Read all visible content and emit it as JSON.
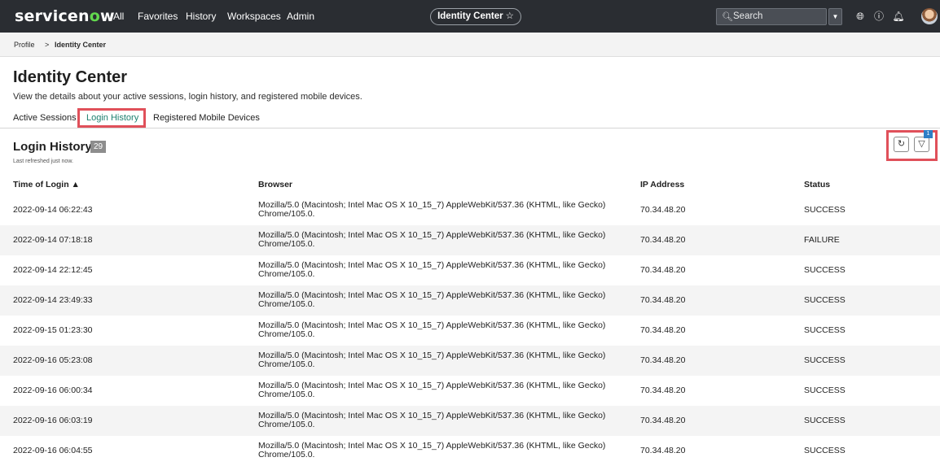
{
  "nav": {
    "logo_prefix": "servicen",
    "logo_o": "o",
    "logo_suffix": "w",
    "links": [
      "All",
      "Favorites",
      "History",
      "Workspaces",
      "Admin"
    ],
    "center_title": "Identity Center",
    "center_star": "☆",
    "search_placeholder": "Search"
  },
  "breadcrumb": {
    "items": [
      "Profile",
      "Identity Center"
    ],
    "separator": ">"
  },
  "page": {
    "title": "Identity Center",
    "description": "View the details about your active sessions, login history, and registered mobile devices."
  },
  "tabs": [
    {
      "label": "Active Sessions",
      "active": false
    },
    {
      "label": "Login History",
      "active": true
    },
    {
      "label": "Registered Mobile Devices",
      "active": false
    }
  ],
  "section": {
    "title": "Login History",
    "count": "29",
    "refreshed": "Last refreshed just now.",
    "filter_badge": "1"
  },
  "table": {
    "headers": [
      "Time of Login ▲",
      "Browser",
      "IP Address",
      "Status"
    ],
    "rows": [
      {
        "time": "2022-09-14 06:22:43",
        "browser_l1": "Mozilla/5.0 (Macintosh; Intel Mac OS X 10_15_7) AppleWebKit/537.36 (KHTML, like Gecko)",
        "browser_l2": "Chrome/105.0.",
        "ip": "70.34.48.20",
        "status": "SUCCESS"
      },
      {
        "time": "2022-09-14 07:18:18",
        "browser_l1": "Mozilla/5.0 (Macintosh; Intel Mac OS X 10_15_7) AppleWebKit/537.36 (KHTML, like Gecko)",
        "browser_l2": "Chrome/105.0.",
        "ip": "70.34.48.20",
        "status": "FAILURE"
      },
      {
        "time": "2022-09-14 22:12:45",
        "browser_l1": "Mozilla/5.0 (Macintosh; Intel Mac OS X 10_15_7) AppleWebKit/537.36 (KHTML, like Gecko)",
        "browser_l2": "Chrome/105.0.",
        "ip": "70.34.48.20",
        "status": "SUCCESS"
      },
      {
        "time": "2022-09-14 23:49:33",
        "browser_l1": "Mozilla/5.0 (Macintosh; Intel Mac OS X 10_15_7) AppleWebKit/537.36 (KHTML, like Gecko)",
        "browser_l2": "Chrome/105.0.",
        "ip": "70.34.48.20",
        "status": "SUCCESS"
      },
      {
        "time": "2022-09-15 01:23:30",
        "browser_l1": "Mozilla/5.0 (Macintosh; Intel Mac OS X 10_15_7) AppleWebKit/537.36 (KHTML, like Gecko)",
        "browser_l2": "Chrome/105.0.",
        "ip": "70.34.48.20",
        "status": "SUCCESS"
      },
      {
        "time": "2022-09-16 05:23:08",
        "browser_l1": "Mozilla/5.0 (Macintosh; Intel Mac OS X 10_15_7) AppleWebKit/537.36 (KHTML, like Gecko)",
        "browser_l2": "Chrome/105.0.",
        "ip": "70.34.48.20",
        "status": "SUCCESS"
      },
      {
        "time": "2022-09-16 06:00:34",
        "browser_l1": "Mozilla/5.0 (Macintosh; Intel Mac OS X 10_15_7) AppleWebKit/537.36 (KHTML, like Gecko)",
        "browser_l2": "Chrome/105.0.",
        "ip": "70.34.48.20",
        "status": "SUCCESS"
      },
      {
        "time": "2022-09-16 06:03:19",
        "browser_l1": "Mozilla/5.0 (Macintosh; Intel Mac OS X 10_15_7) AppleWebKit/537.36 (KHTML, like Gecko)",
        "browser_l2": "Chrome/105.0.",
        "ip": "70.34.48.20",
        "status": "SUCCESS"
      },
      {
        "time": "2022-09-16 06:04:55",
        "browser_l1": "Mozilla/5.0 (Macintosh; Intel Mac OS X 10_15_7) AppleWebKit/537.36 (KHTML, like Gecko)",
        "browser_l2": "Chrome/105.0.",
        "ip": "70.34.48.20",
        "status": "SUCCESS"
      }
    ]
  },
  "icons": [
    "search-icon",
    "chevron-down-icon",
    "globe-icon",
    "help-icon",
    "bell-icon",
    "avatar",
    "refresh-icon",
    "filter-icon"
  ],
  "colors": {
    "nav_bg": "#2a2d32",
    "logo_accent": "#62d84e",
    "active_tab": "#1c7f6f",
    "highlight": "#e0505a",
    "badge": "#2d7ec6"
  }
}
